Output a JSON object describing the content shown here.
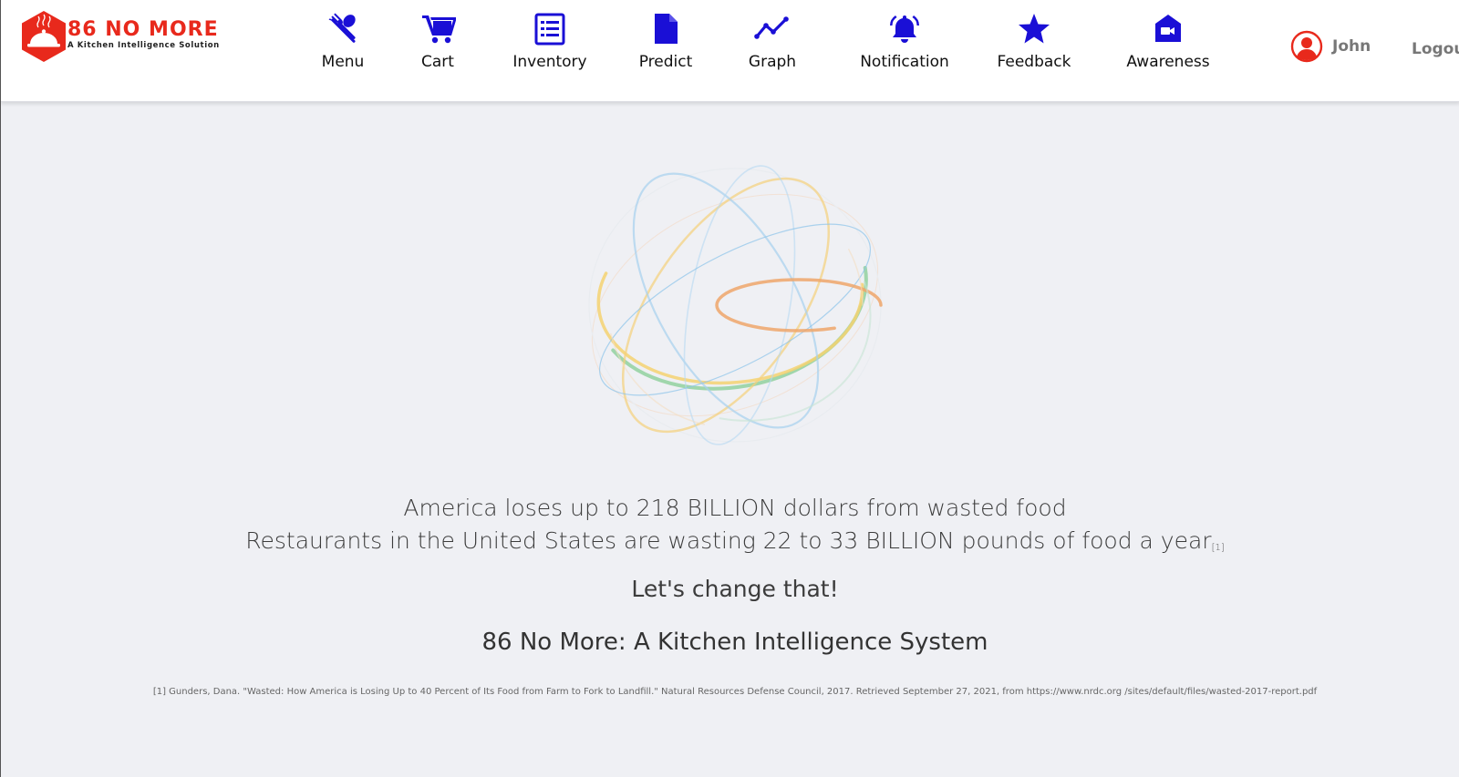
{
  "brand": {
    "title": "86 NO MORE",
    "subtitle": "A Kitchen Intelligence Solution",
    "title_color": "#e8291c",
    "badge_icon": "cloche-icon"
  },
  "nav": {
    "icon_color": "#1a0fd6",
    "items": [
      {
        "label": "Menu",
        "icon": "utensils-icon"
      },
      {
        "label": "Cart",
        "icon": "cart-icon"
      },
      {
        "label": "Inventory",
        "icon": "list-icon"
      },
      {
        "label": "Predict",
        "icon": "document-icon"
      },
      {
        "label": "Graph",
        "icon": "line-chart-icon"
      },
      {
        "label": "Notification",
        "icon": "bell-icon"
      },
      {
        "label": "Feedback",
        "icon": "star-icon"
      },
      {
        "label": "Awareness",
        "icon": "video-house-icon"
      }
    ]
  },
  "user": {
    "name": "John",
    "icon": "user-circle-icon",
    "icon_color": "#e8291c",
    "logout_label": "Logou"
  },
  "main": {
    "stat_line_1": "America loses up to 218 BILLION dollars from wasted food",
    "stat_line_2": "Restaurants in the United States are wasting 22 to 33 BILLION pounds of food a year",
    "citation_marker": "[1]",
    "call_to_action": "Let's change that!",
    "system_title": "86 No More: A Kitchen Intelligence System",
    "footnote": "[1] Gunders, Dana. \"Wasted: How America is Losing Up to 40 Percent of Its Food from Farm to Fork to Landfill.\" Natural Resources Defense Council, 2017. Retrieved September 27, 2021, from https://www.nrdc.org /sites/default/files/wasted-2017-report.pdf"
  }
}
